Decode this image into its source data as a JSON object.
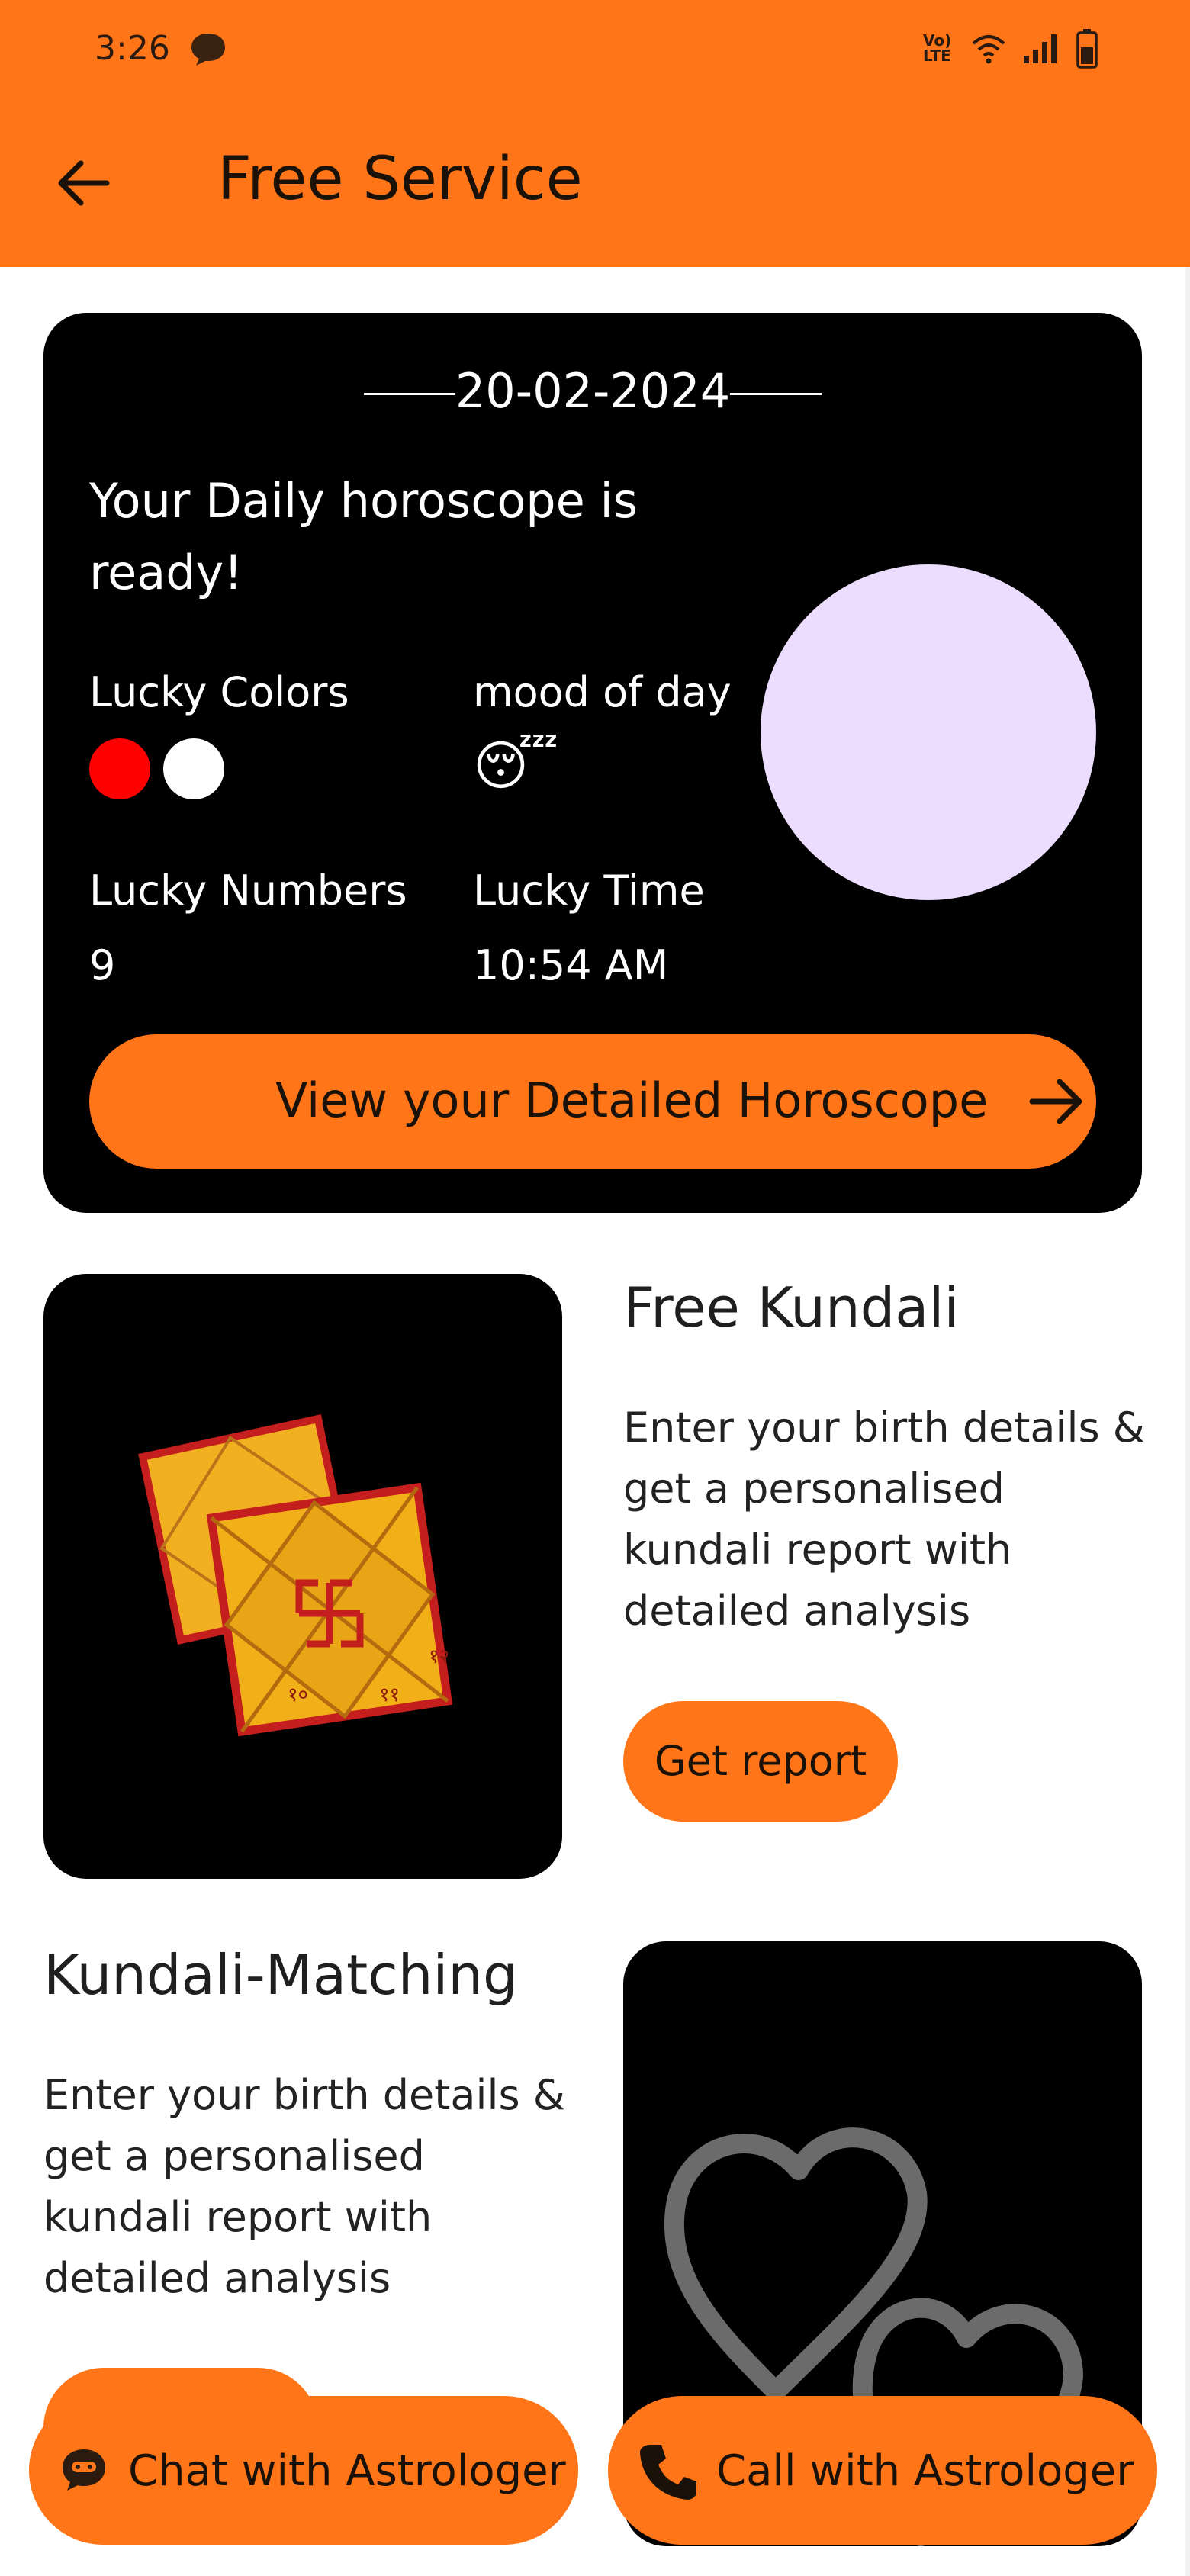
{
  "status_bar": {
    "time": "3:26",
    "network_label": "Vo) LTE"
  },
  "appbar": {
    "title": "Free Service"
  },
  "horoscope": {
    "date": "20-02-2024",
    "heading": "Your Daily horoscope is ready!",
    "lucky_colors_label": "Lucky Colors",
    "lucky_colors": [
      "#ff0000",
      "#ffffff"
    ],
    "mood_label": "mood of day",
    "mood_emoji": "😴",
    "lucky_numbers_label": "Lucky Numbers",
    "lucky_numbers": "9",
    "lucky_time_label": "Lucky Time",
    "lucky_time": "10:54 AM",
    "button_label": "View your Detailed Horoscope"
  },
  "free_kundali": {
    "title": "Free Kundali",
    "description": "Enter your birth details & get a personalised kundali report with detailed analysis",
    "button_label": "Get report"
  },
  "kundali_matching": {
    "title": "Kundali-Matching",
    "description": "Enter your birth details & get a personalised kundali report with detailed analysis"
  },
  "actions": {
    "chat_label": "Chat with Astrologer",
    "call_label": "Call with Astrologer"
  },
  "colors": {
    "accent": "#ff7518",
    "card": "#000000",
    "circle": "#ecdcfd"
  }
}
